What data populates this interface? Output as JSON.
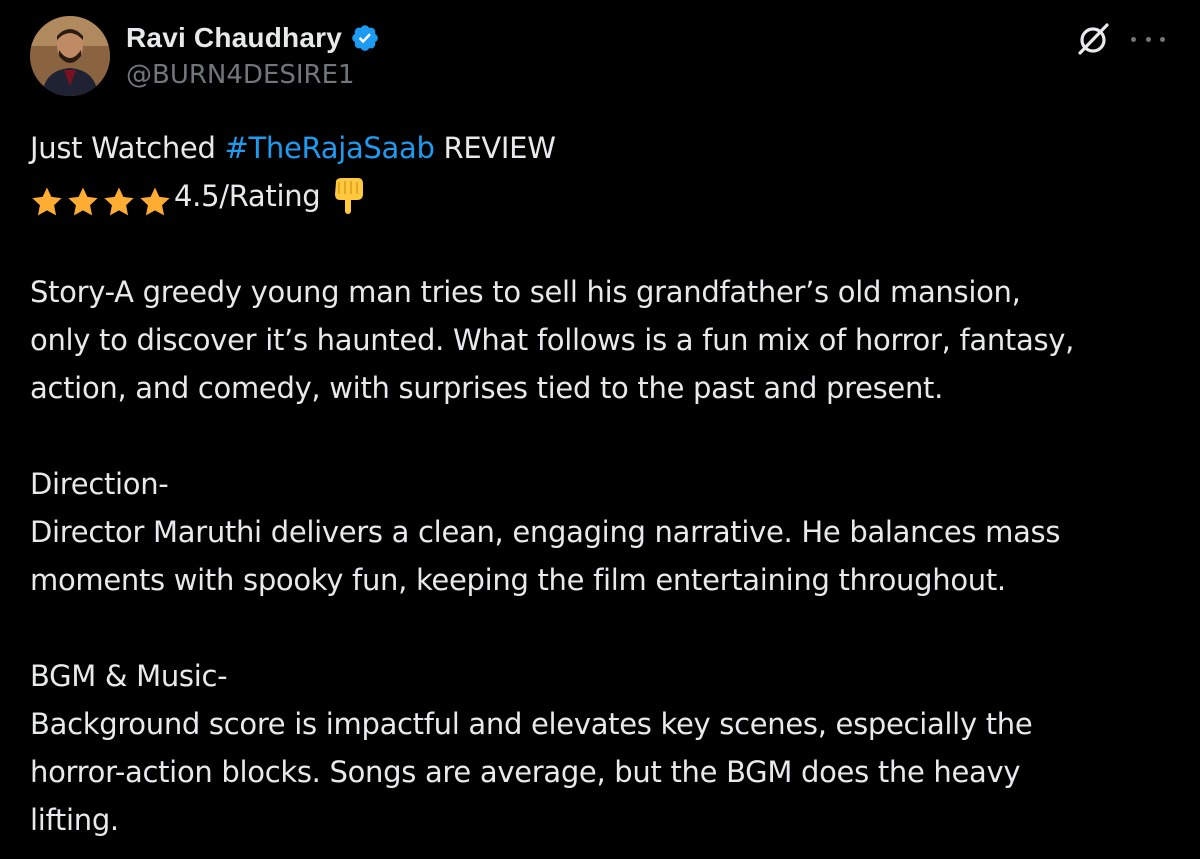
{
  "author": {
    "display_name": "Ravi Chaudhary",
    "handle": "@BURN4DESIRE1",
    "verified": true,
    "verified_color": "#1d9bf0"
  },
  "header_icons": [
    "grok-icon",
    "more-icon"
  ],
  "tweet": {
    "line1_prefix": "Just Watched ",
    "hashtag": "#TheRajaSaab",
    "line1_suffix": " REVIEW",
    "star_count": 4,
    "rating_text": "4.5/Rating",
    "rating_emoji": "backhand-index-pointing-down-icon",
    "story_lines": [
      "Story-A greedy young man tries to sell his grandfather’s old mansion,",
      "only to discover it’s haunted. What follows is a fun mix of horror, fantasy,",
      "action, and comedy, with surprises tied to the past and present."
    ],
    "direction_heading": "Direction-",
    "direction_lines": [
      "Director Maruthi delivers a clean, engaging narrative. He balances mass",
      "moments with spooky fun, keeping the film entertaining throughout."
    ],
    "music_heading": "BGM & Music-",
    "music_lines": [
      "Background score is impactful and elevates key scenes, especially the",
      "horror-action blocks. Songs are average, but the BGM does the heavy",
      "lifting."
    ]
  },
  "colors": {
    "background": "#000000",
    "text": "#e7e9ea",
    "secondary_text": "#71767b",
    "link": "#1d9bf0",
    "star": "#ffac33"
  }
}
